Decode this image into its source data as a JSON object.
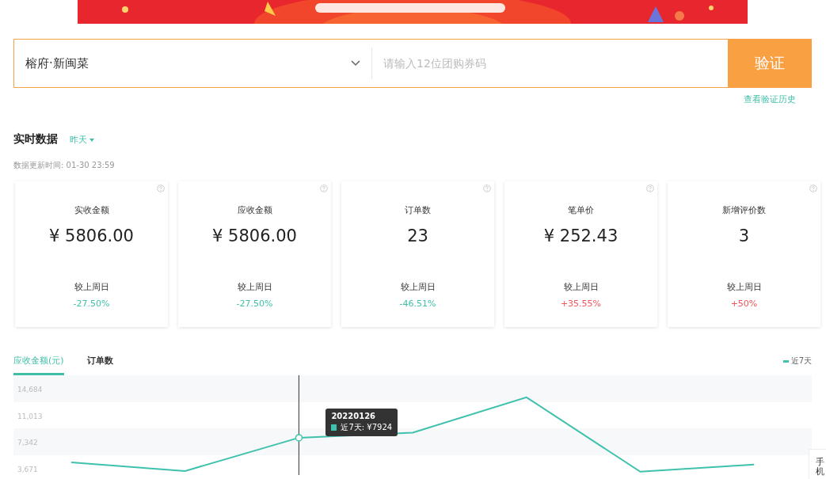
{
  "verify": {
    "store": "榕府·新闽菜",
    "placeholder": "请输入12位团购券码",
    "button": "验证",
    "history_link": "查看验证历史"
  },
  "realtime": {
    "title": "实时数据",
    "period": "昨天",
    "updated": "数据更新时间: 01-30 23:59"
  },
  "cards": [
    {
      "label": "实收金额",
      "value": "¥ 5806.00",
      "compare": "较上周日",
      "change": "-27.50%",
      "color": "#3fbfa8"
    },
    {
      "label": "应收金额",
      "value": "¥ 5806.00",
      "compare": "较上周日",
      "change": "-27.50%",
      "color": "#3fbfa8"
    },
    {
      "label": "订单数",
      "value": "23",
      "compare": "较上周日",
      "change": "-46.51%",
      "color": "#3fbfa8"
    },
    {
      "label": "笔单价",
      "value": "¥ 252.43",
      "compare": "较上周日",
      "change": "+35.55%",
      "color": "#f2545b"
    },
    {
      "label": "新增评价数",
      "value": "3",
      "compare": "较上周日",
      "change": "+50%",
      "color": "#f2545b"
    }
  ],
  "chart_tabs": [
    {
      "label": "应收金额(元)",
      "selected": true
    },
    {
      "label": "订单数",
      "selected": false
    }
  ],
  "chart": {
    "tooltip": {
      "title": "20220126",
      "text": "近7天: ¥7924"
    },
    "chart_data": {
      "type": "line",
      "ylim": [
        2740,
        16547
      ],
      "categories": [
        null,
        null,
        null,
        null,
        null,
        null,
        null
      ],
      "yticks": [
        {
          "value": 14684,
          "label": "14,684"
        },
        {
          "value": 11013,
          "label": "11,013"
        },
        {
          "value": 7342,
          "label": "7,342"
        },
        {
          "value": 3671,
          "label": "3,671"
        }
      ],
      "series": [
        {
          "name": "近7天",
          "color": "#3fc1ad",
          "values": [
            4500,
            3300,
            7900,
            8600,
            13500,
            3200,
            4200
          ]
        }
      ]
    }
  },
  "side_tab": "手机"
}
